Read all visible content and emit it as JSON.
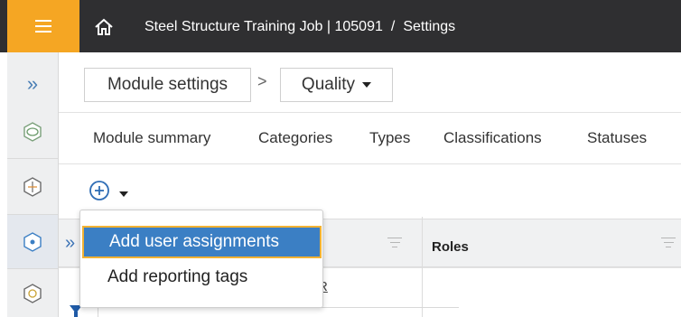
{
  "topbar": {
    "menu_icon": "hamburger-icon",
    "home_icon": "home-icon",
    "project": "Steel Structure Training Job | 105091",
    "separator": "/",
    "page": "Settings"
  },
  "rail": {
    "expand_glyph": "»",
    "icons": [
      "connection-hex-icon",
      "structure-hex-icon",
      "quality-hex-icon",
      "hazard-hex-icon"
    ]
  },
  "settings_bar": {
    "module_label": "Module settings",
    "chevron": ">",
    "module_value": "Quality"
  },
  "tabs": [
    "Module summary",
    "Categories",
    "Types",
    "Classifications",
    "Statuses"
  ],
  "grid": {
    "expand_glyph": "»",
    "roles_header": "Roles",
    "partial_cell": "R"
  },
  "dropdown": {
    "items": [
      "Add user assignments",
      "Add reporting tags"
    ]
  },
  "colors": {
    "topbar": "#2f2f31",
    "accent": "#f5a623",
    "selected": "#3b7fc4",
    "link_blue": "#3b72b5"
  }
}
